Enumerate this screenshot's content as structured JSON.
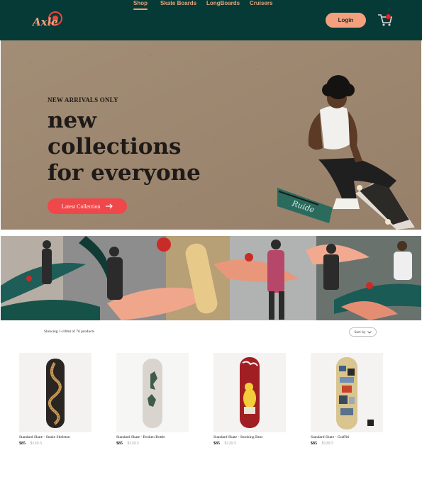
{
  "brand": {
    "logo_text": "Axle",
    "colors": {
      "header_bg": "#063a36",
      "accent": "#f2a07e",
      "cta": "#f0474a"
    }
  },
  "nav": {
    "items": [
      {
        "label": "Shop",
        "active": true
      },
      {
        "label": "Skate Boards",
        "active": false
      },
      {
        "label": "LongBoards",
        "active": false
      },
      {
        "label": "Cruisers",
        "active": false
      }
    ],
    "login_label": "Login",
    "cart_icon": "cart-icon"
  },
  "hero": {
    "eyebrow": "NEW ARRIVALS ONLY",
    "title_lines": [
      "new",
      "collections",
      "for everyone"
    ],
    "cta_label": "Latest Collection",
    "cta_icon": "arrow-right-icon"
  },
  "listing": {
    "results_text": "Showing 1-100ut of 76 products",
    "sort_label": "Sort by",
    "sort_icon": "chevron-down-icon"
  },
  "products": [
    {
      "name": "Standard Skate - Snake Skeleton",
      "price": "$85",
      "old_price": "$120.5"
    },
    {
      "name": "Standard Skate - Broken Bottle",
      "price": "$85",
      "old_price": "$120.5"
    },
    {
      "name": "Standard Skate - Smoking Bear",
      "price": "$85",
      "old_price": "$120.5"
    },
    {
      "name": "Standard Skate - Graffiti",
      "price": "$85",
      "old_price": "$120.5"
    }
  ]
}
